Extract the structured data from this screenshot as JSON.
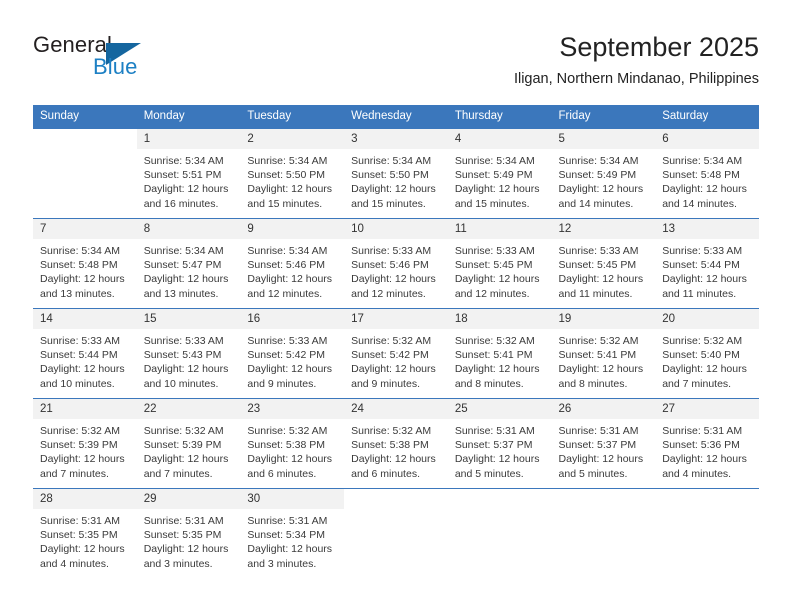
{
  "brand": {
    "name_part1": "General",
    "name_part2": "Blue",
    "logo_icon": "triangle-icon"
  },
  "header": {
    "title": "September 2025",
    "location": "Iligan, Northern Mindanao, Philippines"
  },
  "colors": {
    "header_blue": "#3b77bc",
    "brand_blue": "#1d80c4",
    "logo_blue": "#15669f",
    "daynum_band": "#f2f2f2",
    "text": "#3a3a3a"
  },
  "labels": {
    "sunrise_prefix": "Sunrise:",
    "sunset_prefix": "Sunset:",
    "daylight_prefix": "Daylight:"
  },
  "weekdays": [
    "Sunday",
    "Monday",
    "Tuesday",
    "Wednesday",
    "Thursday",
    "Friday",
    "Saturday"
  ],
  "weeks": [
    [
      {
        "day": "",
        "empty": true,
        "sunrise": "",
        "sunset": "",
        "daylight_line1": "",
        "daylight_line2": ""
      },
      {
        "day": "1",
        "empty": false,
        "sunrise": "Sunrise: 5:34 AM",
        "sunset": "Sunset: 5:51 PM",
        "daylight_line1": "Daylight: 12 hours",
        "daylight_line2": "and 16 minutes."
      },
      {
        "day": "2",
        "empty": false,
        "sunrise": "Sunrise: 5:34 AM",
        "sunset": "Sunset: 5:50 PM",
        "daylight_line1": "Daylight: 12 hours",
        "daylight_line2": "and 15 minutes."
      },
      {
        "day": "3",
        "empty": false,
        "sunrise": "Sunrise: 5:34 AM",
        "sunset": "Sunset: 5:50 PM",
        "daylight_line1": "Daylight: 12 hours",
        "daylight_line2": "and 15 minutes."
      },
      {
        "day": "4",
        "empty": false,
        "sunrise": "Sunrise: 5:34 AM",
        "sunset": "Sunset: 5:49 PM",
        "daylight_line1": "Daylight: 12 hours",
        "daylight_line2": "and 15 minutes."
      },
      {
        "day": "5",
        "empty": false,
        "sunrise": "Sunrise: 5:34 AM",
        "sunset": "Sunset: 5:49 PM",
        "daylight_line1": "Daylight: 12 hours",
        "daylight_line2": "and 14 minutes."
      },
      {
        "day": "6",
        "empty": false,
        "sunrise": "Sunrise: 5:34 AM",
        "sunset": "Sunset: 5:48 PM",
        "daylight_line1": "Daylight: 12 hours",
        "daylight_line2": "and 14 minutes."
      }
    ],
    [
      {
        "day": "7",
        "empty": false,
        "sunrise": "Sunrise: 5:34 AM",
        "sunset": "Sunset: 5:48 PM",
        "daylight_line1": "Daylight: 12 hours",
        "daylight_line2": "and 13 minutes."
      },
      {
        "day": "8",
        "empty": false,
        "sunrise": "Sunrise: 5:34 AM",
        "sunset": "Sunset: 5:47 PM",
        "daylight_line1": "Daylight: 12 hours",
        "daylight_line2": "and 13 minutes."
      },
      {
        "day": "9",
        "empty": false,
        "sunrise": "Sunrise: 5:34 AM",
        "sunset": "Sunset: 5:46 PM",
        "daylight_line1": "Daylight: 12 hours",
        "daylight_line2": "and 12 minutes."
      },
      {
        "day": "10",
        "empty": false,
        "sunrise": "Sunrise: 5:33 AM",
        "sunset": "Sunset: 5:46 PM",
        "daylight_line1": "Daylight: 12 hours",
        "daylight_line2": "and 12 minutes."
      },
      {
        "day": "11",
        "empty": false,
        "sunrise": "Sunrise: 5:33 AM",
        "sunset": "Sunset: 5:45 PM",
        "daylight_line1": "Daylight: 12 hours",
        "daylight_line2": "and 12 minutes."
      },
      {
        "day": "12",
        "empty": false,
        "sunrise": "Sunrise: 5:33 AM",
        "sunset": "Sunset: 5:45 PM",
        "daylight_line1": "Daylight: 12 hours",
        "daylight_line2": "and 11 minutes."
      },
      {
        "day": "13",
        "empty": false,
        "sunrise": "Sunrise: 5:33 AM",
        "sunset": "Sunset: 5:44 PM",
        "daylight_line1": "Daylight: 12 hours",
        "daylight_line2": "and 11 minutes."
      }
    ],
    [
      {
        "day": "14",
        "empty": false,
        "sunrise": "Sunrise: 5:33 AM",
        "sunset": "Sunset: 5:44 PM",
        "daylight_line1": "Daylight: 12 hours",
        "daylight_line2": "and 10 minutes."
      },
      {
        "day": "15",
        "empty": false,
        "sunrise": "Sunrise: 5:33 AM",
        "sunset": "Sunset: 5:43 PM",
        "daylight_line1": "Daylight: 12 hours",
        "daylight_line2": "and 10 minutes."
      },
      {
        "day": "16",
        "empty": false,
        "sunrise": "Sunrise: 5:33 AM",
        "sunset": "Sunset: 5:42 PM",
        "daylight_line1": "Daylight: 12 hours",
        "daylight_line2": "and 9 minutes."
      },
      {
        "day": "17",
        "empty": false,
        "sunrise": "Sunrise: 5:32 AM",
        "sunset": "Sunset: 5:42 PM",
        "daylight_line1": "Daylight: 12 hours",
        "daylight_line2": "and 9 minutes."
      },
      {
        "day": "18",
        "empty": false,
        "sunrise": "Sunrise: 5:32 AM",
        "sunset": "Sunset: 5:41 PM",
        "daylight_line1": "Daylight: 12 hours",
        "daylight_line2": "and 8 minutes."
      },
      {
        "day": "19",
        "empty": false,
        "sunrise": "Sunrise: 5:32 AM",
        "sunset": "Sunset: 5:41 PM",
        "daylight_line1": "Daylight: 12 hours",
        "daylight_line2": "and 8 minutes."
      },
      {
        "day": "20",
        "empty": false,
        "sunrise": "Sunrise: 5:32 AM",
        "sunset": "Sunset: 5:40 PM",
        "daylight_line1": "Daylight: 12 hours",
        "daylight_line2": "and 7 minutes."
      }
    ],
    [
      {
        "day": "21",
        "empty": false,
        "sunrise": "Sunrise: 5:32 AM",
        "sunset": "Sunset: 5:39 PM",
        "daylight_line1": "Daylight: 12 hours",
        "daylight_line2": "and 7 minutes."
      },
      {
        "day": "22",
        "empty": false,
        "sunrise": "Sunrise: 5:32 AM",
        "sunset": "Sunset: 5:39 PM",
        "daylight_line1": "Daylight: 12 hours",
        "daylight_line2": "and 7 minutes."
      },
      {
        "day": "23",
        "empty": false,
        "sunrise": "Sunrise: 5:32 AM",
        "sunset": "Sunset: 5:38 PM",
        "daylight_line1": "Daylight: 12 hours",
        "daylight_line2": "and 6 minutes."
      },
      {
        "day": "24",
        "empty": false,
        "sunrise": "Sunrise: 5:32 AM",
        "sunset": "Sunset: 5:38 PM",
        "daylight_line1": "Daylight: 12 hours",
        "daylight_line2": "and 6 minutes."
      },
      {
        "day": "25",
        "empty": false,
        "sunrise": "Sunrise: 5:31 AM",
        "sunset": "Sunset: 5:37 PM",
        "daylight_line1": "Daylight: 12 hours",
        "daylight_line2": "and 5 minutes."
      },
      {
        "day": "26",
        "empty": false,
        "sunrise": "Sunrise: 5:31 AM",
        "sunset": "Sunset: 5:37 PM",
        "daylight_line1": "Daylight: 12 hours",
        "daylight_line2": "and 5 minutes."
      },
      {
        "day": "27",
        "empty": false,
        "sunrise": "Sunrise: 5:31 AM",
        "sunset": "Sunset: 5:36 PM",
        "daylight_line1": "Daylight: 12 hours",
        "daylight_line2": "and 4 minutes."
      }
    ],
    [
      {
        "day": "28",
        "empty": false,
        "sunrise": "Sunrise: 5:31 AM",
        "sunset": "Sunset: 5:35 PM",
        "daylight_line1": "Daylight: 12 hours",
        "daylight_line2": "and 4 minutes."
      },
      {
        "day": "29",
        "empty": false,
        "sunrise": "Sunrise: 5:31 AM",
        "sunset": "Sunset: 5:35 PM",
        "daylight_line1": "Daylight: 12 hours",
        "daylight_line2": "and 3 minutes."
      },
      {
        "day": "30",
        "empty": false,
        "sunrise": "Sunrise: 5:31 AM",
        "sunset": "Sunset: 5:34 PM",
        "daylight_line1": "Daylight: 12 hours",
        "daylight_line2": "and 3 minutes."
      },
      {
        "day": "",
        "empty": true,
        "sunrise": "",
        "sunset": "",
        "daylight_line1": "",
        "daylight_line2": ""
      },
      {
        "day": "",
        "empty": true,
        "sunrise": "",
        "sunset": "",
        "daylight_line1": "",
        "daylight_line2": ""
      },
      {
        "day": "",
        "empty": true,
        "sunrise": "",
        "sunset": "",
        "daylight_line1": "",
        "daylight_line2": ""
      },
      {
        "day": "",
        "empty": true,
        "sunrise": "",
        "sunset": "",
        "daylight_line1": "",
        "daylight_line2": ""
      }
    ]
  ]
}
